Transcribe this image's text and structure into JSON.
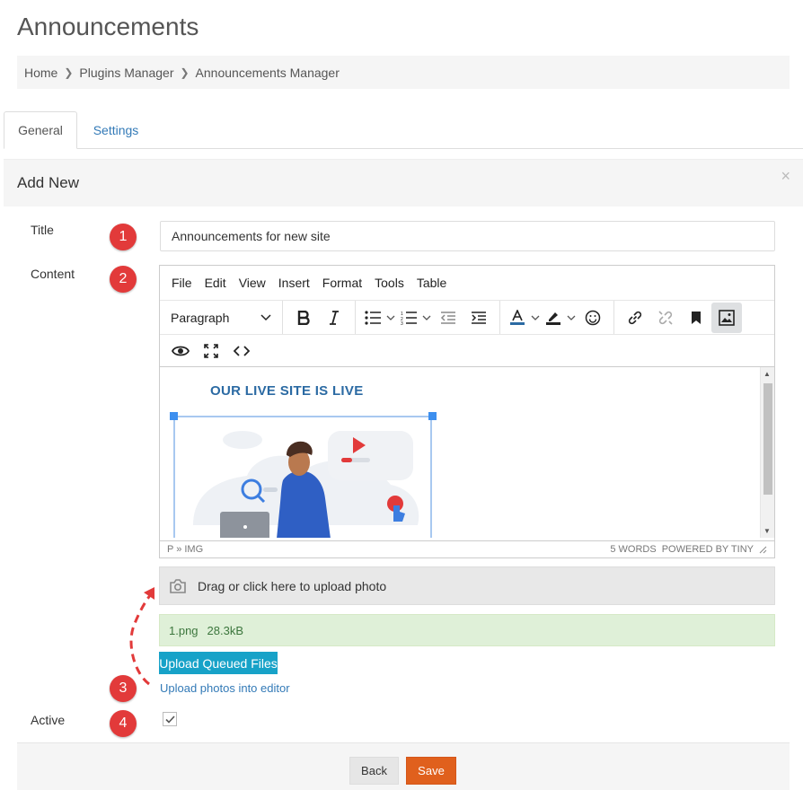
{
  "page": {
    "title": "Announcements"
  },
  "breadcrumb": [
    "Home",
    "Plugins Manager",
    "Announcements Manager"
  ],
  "tabs": [
    {
      "label": "General",
      "active": true
    },
    {
      "label": "Settings",
      "active": false
    }
  ],
  "panel": {
    "title": "Add New",
    "close": "×"
  },
  "form": {
    "title_label": "Title",
    "title_value": "Announcements for new site",
    "content_label": "Content",
    "active_label": "Active",
    "active_checked": true
  },
  "markers": [
    "1",
    "2",
    "3",
    "4"
  ],
  "editor": {
    "menu": [
      "File",
      "Edit",
      "View",
      "Insert",
      "Format",
      "Tools",
      "Table"
    ],
    "block_format": "Paragraph",
    "content_heading": "OUR LIVE SITE IS LIVE",
    "status_path": "P » IMG",
    "status_words": "5 WORDS",
    "status_powered": "POWERED BY TINY"
  },
  "upload": {
    "dropzone_text": "Drag or click here to upload photo",
    "file_name": "1.png",
    "file_size": "28.3kB",
    "queue_button": "Upload Queued Files",
    "insert_link": "Upload photos into editor"
  },
  "footer": {
    "back_label": "Back",
    "save_label": "Save"
  },
  "colors": {
    "accent_link": "#337ab7",
    "save": "#e0601d",
    "upload_btn": "#17a2c8",
    "marker": "#e23a3a",
    "file_ok_bg": "#dff0d8"
  }
}
